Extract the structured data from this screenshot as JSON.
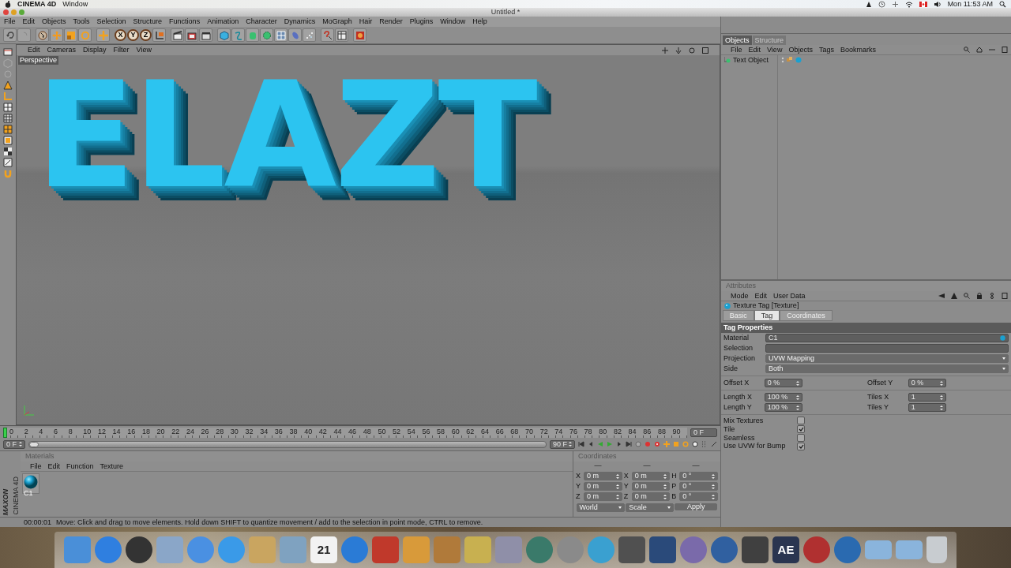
{
  "mac_menubar": {
    "app": "CINEMA 4D",
    "menus": [
      "Window"
    ],
    "clock": "Mon 11:53 AM"
  },
  "window": {
    "title": "Untitled *"
  },
  "menu": [
    "File",
    "Edit",
    "Objects",
    "Tools",
    "Selection",
    "Structure",
    "Functions",
    "Animation",
    "Character",
    "Dynamics",
    "MoGraph",
    "Hair",
    "Render",
    "Plugins",
    "Window",
    "Help"
  ],
  "toolbar": {
    "axes": [
      "X",
      "Y",
      "Z"
    ]
  },
  "viewport": {
    "menu": [
      "Edit",
      "Cameras",
      "Display",
      "Filter",
      "View"
    ],
    "camera": "Perspective",
    "scene_text": "ELAZT"
  },
  "objects": {
    "tabs": [
      {
        "label": "Objects",
        "selected": true
      },
      {
        "label": "Structure",
        "selected": false
      }
    ],
    "menu": [
      "File",
      "Edit",
      "View",
      "Objects",
      "Tags",
      "Bookmarks"
    ],
    "items": [
      {
        "name": "Text Object"
      }
    ]
  },
  "attributes": {
    "title": "Attributes",
    "menu": [
      "Mode",
      "Edit",
      "User Data"
    ],
    "object": "Texture Tag [Texture]",
    "tabs": [
      {
        "label": "Basic",
        "selected": false
      },
      {
        "label": "Tag",
        "selected": true
      },
      {
        "label": "Coordinates",
        "selected": false
      }
    ],
    "section": "Tag Properties",
    "fields": [
      {
        "label": "Material",
        "kind": "link",
        "value": "C1"
      },
      {
        "label": "Selection",
        "kind": "link"
      },
      {
        "label": "Projection",
        "kind": "dropdown",
        "value": "UVW Mapping"
      },
      {
        "label": "Side",
        "kind": "dropdown",
        "value": "Both"
      }
    ],
    "pairs": [
      {
        "left": {
          "label": "Offset X",
          "value": "0 %"
        },
        "right": {
          "label": "Offset Y",
          "value": "0 %"
        }
      },
      {
        "left": {
          "label": "Length X",
          "value": "100 %"
        },
        "right": {
          "label": "Tiles X",
          "value": "1"
        }
      },
      {
        "left": {
          "label": "Length Y",
          "value": "100 %"
        },
        "right": {
          "label": "Tiles Y",
          "value": "1"
        }
      }
    ],
    "checks": [
      {
        "label": "Mix Textures",
        "checked": false
      },
      {
        "label": "Tile",
        "checked": true
      },
      {
        "label": "Seamless",
        "checked": false
      },
      {
        "label": "Use UVW for Bump",
        "checked": true
      }
    ]
  },
  "timeline": {
    "ticks": [
      "0",
      "2",
      "4",
      "6",
      "8",
      "10",
      "12",
      "14",
      "16",
      "18",
      "20",
      "22",
      "24",
      "26",
      "28",
      "30",
      "32",
      "34",
      "36",
      "38",
      "40",
      "42",
      "44",
      "46",
      "48",
      "50",
      "52",
      "54",
      "56",
      "58",
      "60",
      "62",
      "64",
      "66",
      "68",
      "70",
      "72",
      "74",
      "76",
      "78",
      "80",
      "82",
      "84",
      "86",
      "88",
      "90"
    ],
    "level": 0,
    "frame_field": "0 F",
    "start_field": "0 F",
    "end_field": "90 F"
  },
  "materials": {
    "title": "Materials",
    "menu": [
      "File",
      "Edit",
      "Function",
      "Texture"
    ],
    "items": [
      {
        "name": "C1"
      }
    ]
  },
  "coordinates": {
    "title": "Coordinates",
    "headers": [
      "—",
      "—",
      "—"
    ],
    "rows": [
      {
        "a": "X",
        "pos": "0 m",
        "b": "X",
        "size": "0 m",
        "c": "H",
        "rot": "0 °"
      },
      {
        "a": "Y",
        "pos": "0 m",
        "b": "Y",
        "size": "0 m",
        "c": "P",
        "rot": "0 °"
      },
      {
        "a": "Z",
        "pos": "0 m",
        "b": "Z",
        "size": "0 m",
        "c": "B",
        "rot": "0 °"
      }
    ],
    "dropdowns": [
      "World",
      "Scale"
    ],
    "apply": "Apply"
  },
  "status": {
    "time": "00:00:01",
    "message": "Move: Click and drag to move elements. Hold down SHIFT to quantize movement / add to the selection in point mode, CTRL to remove."
  },
  "branding": {
    "maker": "MAXON",
    "product": "CINEMA 4D"
  },
  "dock": [
    {
      "kind": "tile",
      "color": "#4a8fd8"
    },
    {
      "kind": "round",
      "color": "#2f7fe0"
    },
    {
      "kind": "round",
      "color": "#333333"
    },
    {
      "kind": "tile",
      "color": "#8aa6c8"
    },
    {
      "kind": "round",
      "color": "#4a90e2"
    },
    {
      "kind": "round",
      "color": "#3a9ae8"
    },
    {
      "kind": "tile",
      "color": "#c9a560"
    },
    {
      "kind": "tile",
      "color": "#7fa2c0"
    },
    {
      "kind": "tile",
      "color": "#f2f2f2",
      "label": "21"
    },
    {
      "kind": "round",
      "color": "#2a7bd6"
    },
    {
      "kind": "tile",
      "color": "#c0392b"
    },
    {
      "kind": "tile",
      "color": "#d89a3a"
    },
    {
      "kind": "tile",
      "color": "#b07a3a"
    },
    {
      "kind": "tile",
      "color": "#c8b050"
    },
    {
      "kind": "tile",
      "color": "#8f8fa8"
    },
    {
      "kind": "round",
      "color": "#3a7a6a"
    },
    {
      "kind": "round",
      "color": "#8a8a8a"
    },
    {
      "kind": "round",
      "color": "#3aa0d0"
    },
    {
      "kind": "tile",
      "color": "#505050"
    },
    {
      "kind": "tile",
      "color": "#2a4a7a"
    },
    {
      "kind": "round",
      "color": "#7a6aaa"
    },
    {
      "kind": "round",
      "color": "#3060a0"
    },
    {
      "kind": "tile",
      "color": "#404040"
    },
    {
      "kind": "tile",
      "color": "#2a3550",
      "label": "AE"
    },
    {
      "kind": "round",
      "color": "#b03030"
    },
    {
      "kind": "round",
      "color": "#2a6ab0"
    },
    {
      "kind": "folder",
      "color": "#8ab4dc"
    },
    {
      "kind": "folder",
      "color": "#8ab4dc"
    },
    {
      "kind": "trash",
      "color": "#c8ccd0"
    }
  ]
}
